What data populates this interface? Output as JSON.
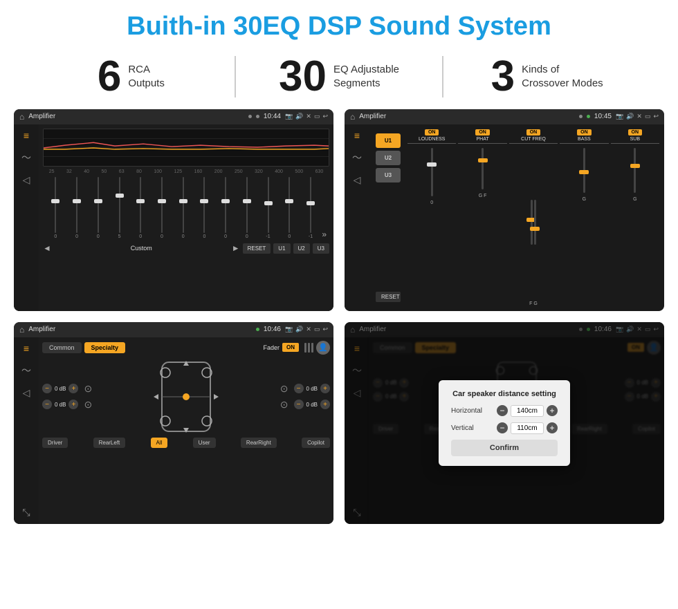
{
  "page": {
    "title": "Buith-in 30EQ DSP Sound System",
    "title_color": "#1a9de1"
  },
  "stats": [
    {
      "number": "6",
      "label_line1": "RCA",
      "label_line2": "Outputs"
    },
    {
      "number": "30",
      "label_line1": "EQ Adjustable",
      "label_line2": "Segments"
    },
    {
      "number": "3",
      "label_line1": "Kinds of",
      "label_line2": "Crossover Modes"
    }
  ],
  "screen1": {
    "status_bar": {
      "title": "Amplifier",
      "time": "10:44"
    },
    "eq_frequencies": [
      "25",
      "32",
      "40",
      "50",
      "63",
      "80",
      "100",
      "125",
      "160",
      "200",
      "250",
      "320",
      "400",
      "500",
      "630"
    ],
    "eq_values": [
      "0",
      "0",
      "0",
      "5",
      "0",
      "0",
      "0",
      "0",
      "0",
      "0",
      "-1",
      "0",
      "-1"
    ],
    "preset": "Custom",
    "buttons": [
      "RESET",
      "U1",
      "U2",
      "U3"
    ]
  },
  "screen2": {
    "status_bar": {
      "title": "Amplifier",
      "time": "10:45"
    },
    "presets": [
      "U1",
      "U2",
      "U3"
    ],
    "controls": [
      "LOUDNESS",
      "PHAT",
      "CUT FREQ",
      "BASS",
      "SUB"
    ],
    "reset_label": "RESET"
  },
  "screen3": {
    "status_bar": {
      "title": "Amplifier",
      "time": "10:46"
    },
    "tabs": [
      "Common",
      "Specialty"
    ],
    "fader_label": "Fader",
    "fader_on": "ON",
    "volumes": [
      "0 dB",
      "0 dB",
      "0 dB",
      "0 dB"
    ],
    "bottom_buttons": [
      "Driver",
      "RearLeft",
      "All",
      "User",
      "RearRight",
      "Copilot"
    ]
  },
  "screen4": {
    "status_bar": {
      "title": "Amplifier",
      "time": "10:46"
    },
    "tabs": [
      "Common",
      "Specialty"
    ],
    "dialog": {
      "title": "Car speaker distance setting",
      "horizontal_label": "Horizontal",
      "horizontal_value": "140cm",
      "vertical_label": "Vertical",
      "vertical_value": "110cm",
      "confirm_label": "Confirm"
    },
    "bottom_buttons": [
      "Driver",
      "RearLeft",
      "All",
      "User",
      "RearRight",
      "Copilot"
    ]
  }
}
